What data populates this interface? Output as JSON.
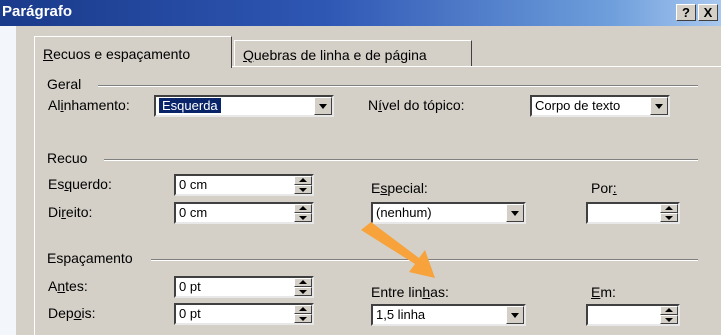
{
  "window": {
    "title": "Parágrafo",
    "help_button": "?",
    "close_button": "X"
  },
  "tabs": [
    {
      "pre": "",
      "key": "R",
      "post": "ecuos e espaçamento"
    },
    {
      "pre": "",
      "key": "Q",
      "post": "uebras de linha e de página"
    }
  ],
  "geral": {
    "label": "Geral",
    "alinhamento": {
      "pre": "Al",
      "key": "i",
      "post": "nhamento:",
      "value": "Esquerda"
    },
    "nivel": {
      "pre": "N",
      "key": "í",
      "post": "vel do tópico:",
      "value": "Corpo de texto"
    }
  },
  "recuo": {
    "label": "Recuo",
    "esquerdo": {
      "pre": "Es",
      "key": "q",
      "post": "uerdo:",
      "value": "0 cm"
    },
    "direito": {
      "pre": "Di",
      "key": "r",
      "post": "eito:",
      "value": "0 cm"
    },
    "especial": {
      "pre": "E",
      "key": "s",
      "post": "pecial:",
      "value": "(nenhum)"
    },
    "por": {
      "pre": "Por",
      "key": ":",
      "post": "",
      "value": ""
    }
  },
  "espacamento": {
    "label": "Espaçamento",
    "antes": {
      "pre": "A",
      "key": "n",
      "post": "tes:",
      "value": "0 pt"
    },
    "depois": {
      "pre": "Dep",
      "key": "o",
      "post": "is:",
      "value": "0 pt"
    },
    "entre_linhas": {
      "pre": "Entre lin",
      "key": "h",
      "post": "as:",
      "value": "1,5 linha"
    },
    "em": {
      "pre": "",
      "key": "E",
      "post": "m:",
      "value": ""
    }
  },
  "colors": {
    "dialog": "#d4d0c8",
    "titlebar_start": "#1a3a8a",
    "highlight": "#0a246a",
    "arrow": "#f7a23a"
  }
}
